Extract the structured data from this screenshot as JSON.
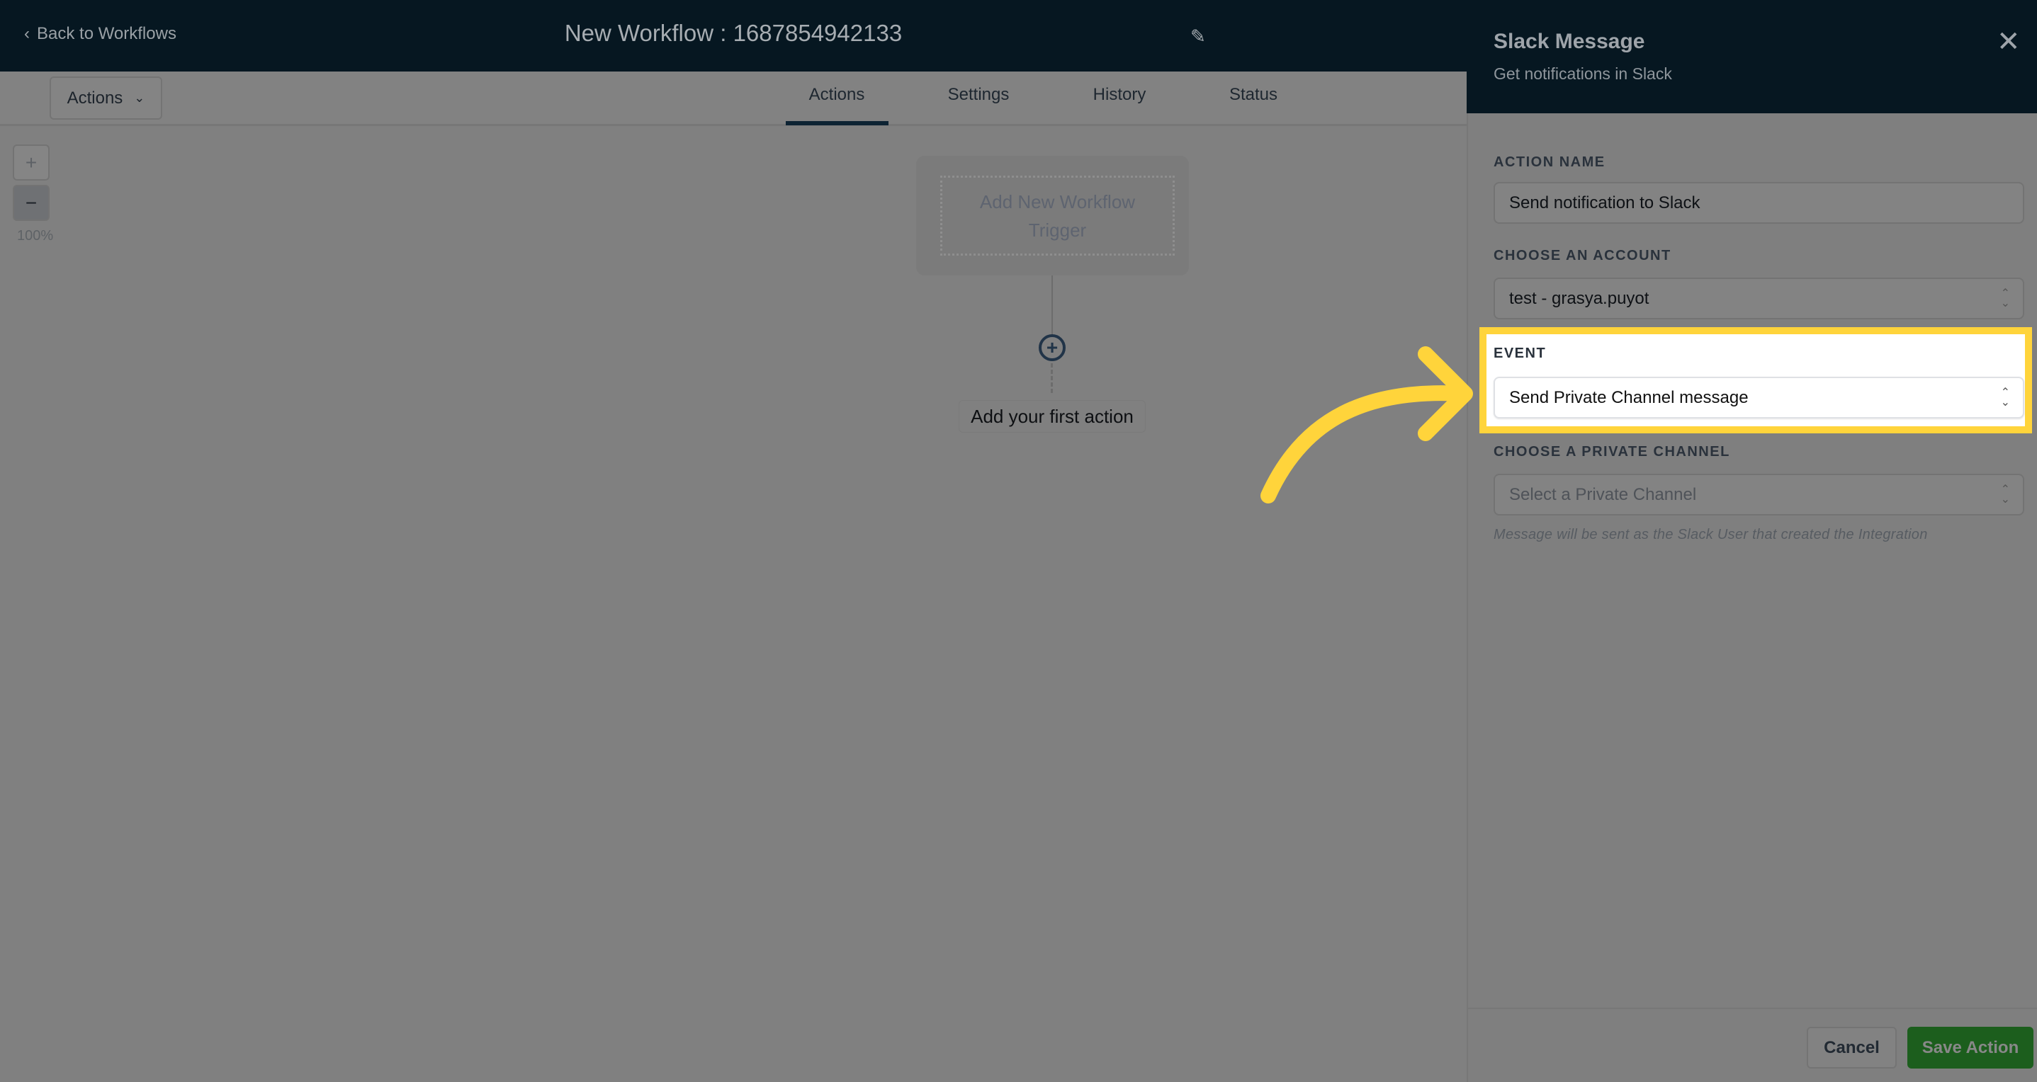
{
  "header": {
    "back_label": "Back to Workflows",
    "title": "New Workflow : 1687854942133"
  },
  "toolbar": {
    "actions_label": "Actions",
    "tabs": [
      {
        "label": "Actions",
        "active": true
      },
      {
        "label": "Settings"
      },
      {
        "label": "History"
      },
      {
        "label": "Status"
      }
    ]
  },
  "canvas": {
    "zoom_in": "+",
    "zoom_out": "−",
    "zoom_level": "100%",
    "trigger_line1": "Add New Workflow",
    "trigger_line2": "Trigger",
    "add_first_action": "Add your first action"
  },
  "panel": {
    "title": "Slack Message",
    "subtitle": "Get notifications in Slack",
    "action_name": {
      "label": "ACTION NAME",
      "value": "Send notification to Slack"
    },
    "account": {
      "label": "CHOOSE AN ACCOUNT",
      "value": "test - grasya.puyot"
    },
    "event": {
      "label": "EVENT",
      "value": "Send Private Channel message"
    },
    "channel": {
      "label": "CHOOSE A PRIVATE CHANNEL",
      "placeholder": "Select a Private Channel",
      "hint": "Message will be sent as the Slack User that created the Integration"
    },
    "cancel_label": "Cancel",
    "save_label": "Save Action"
  },
  "annotation": {
    "highlight_color": "#ffd43b"
  }
}
